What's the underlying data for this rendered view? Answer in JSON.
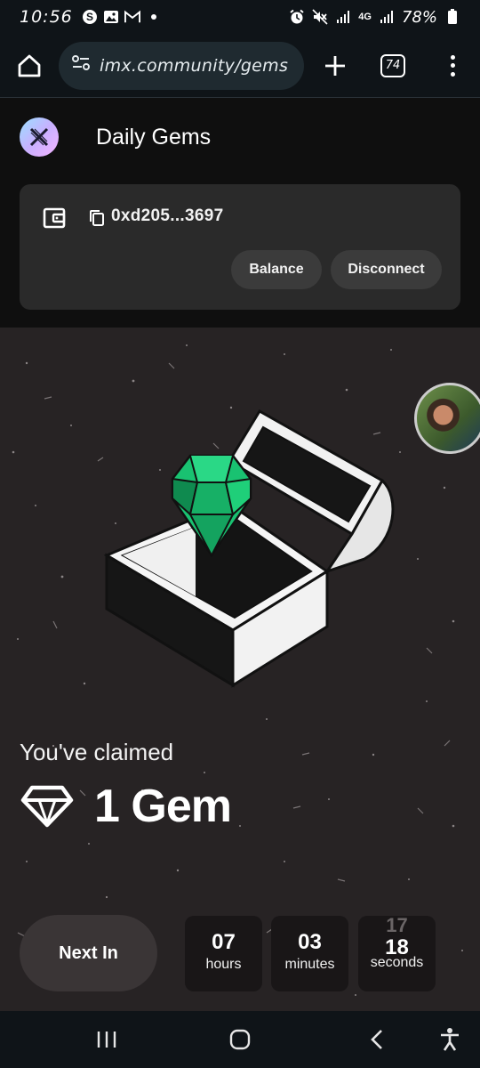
{
  "status_bar": {
    "time": "10:56",
    "battery": "78%",
    "network": "4G",
    "left_icons": [
      "skype-icon",
      "gallery-icon",
      "gmail-icon",
      "dot-icon"
    ],
    "right_icons": [
      "alarm-icon",
      "mute-icon",
      "signal-icon",
      "signal-icon",
      "battery-icon"
    ]
  },
  "browser": {
    "url": "imx.community/gems",
    "tab_count": "74"
  },
  "header": {
    "title": "Daily Gems"
  },
  "wallet": {
    "address": "0xd205...3697",
    "balance_label": "Balance",
    "disconnect_label": "Disconnect"
  },
  "claim": {
    "label": "You've claimed",
    "amount": "1 Gem"
  },
  "timer": {
    "next_label": "Next In",
    "hours": "07",
    "hours_label": "hours",
    "minutes": "03",
    "minutes_label": "minutes",
    "seconds_previous": "17",
    "seconds": "18",
    "seconds_label": "seconds"
  },
  "colors": {
    "gem_green": "#19c271",
    "gem_dark": "#0f8a4f",
    "background": "#272324",
    "card": "#2a2a2a"
  },
  "nav": {
    "items": [
      "recent-apps-icon",
      "home-icon",
      "back-icon",
      "accessibility-icon"
    ]
  }
}
